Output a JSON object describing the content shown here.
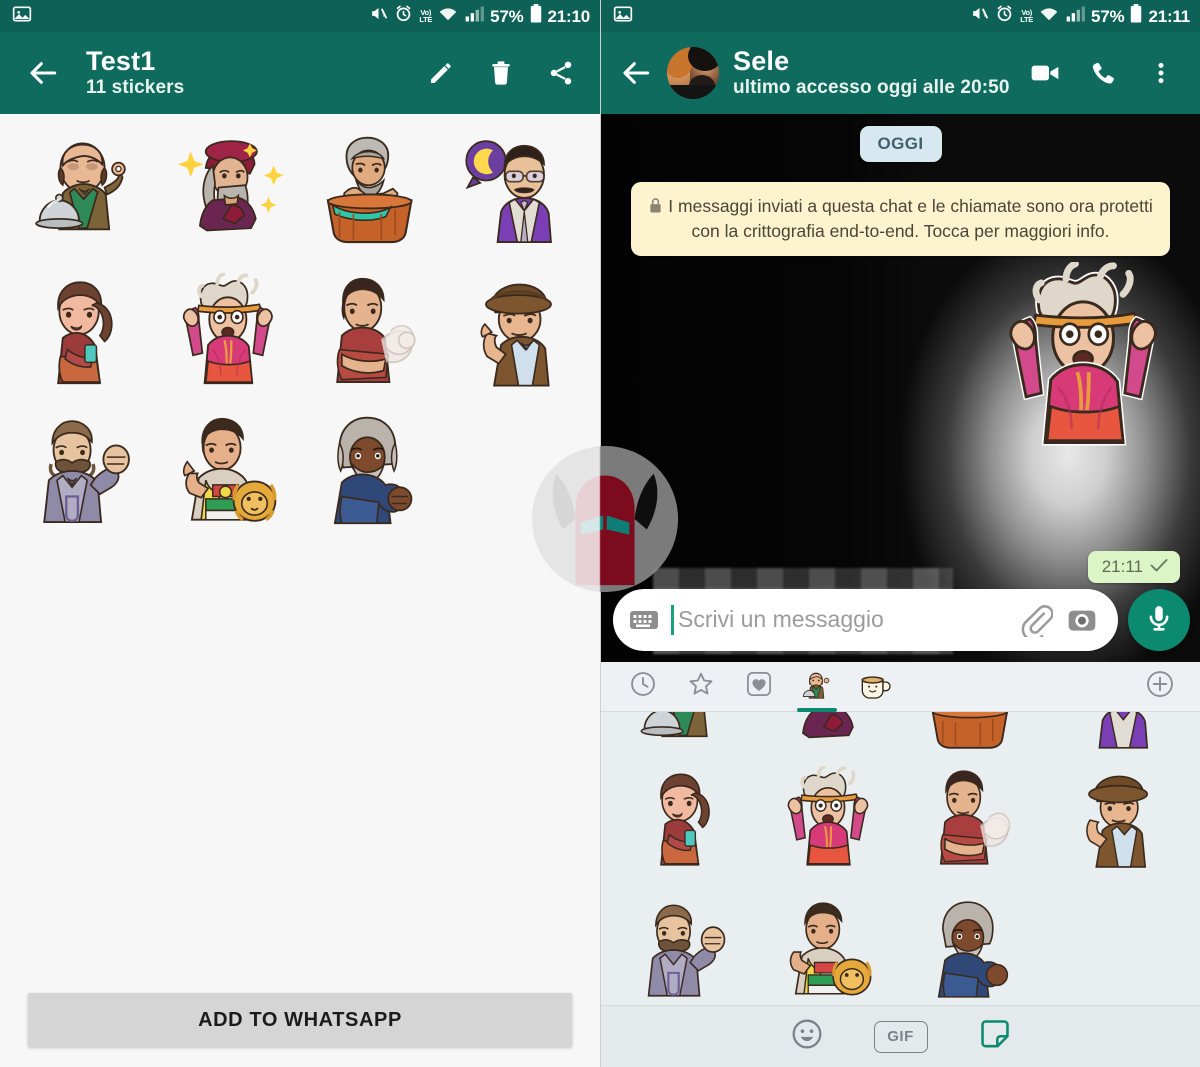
{
  "status_bar": {
    "left_icon": "gallery-icon",
    "icons": [
      "mute-icon",
      "alarm-icon",
      "volte-icon",
      "wifi-icon",
      "signal-icon"
    ],
    "volte_top": "Vo)",
    "volte_bottom": "LTE",
    "battery_percent": "57%",
    "battery_icon": "battery-icon",
    "time_left": "21:10",
    "time_right": "21:11"
  },
  "left_panel": {
    "back_icon": "back-arrow-icon",
    "title": "Test1",
    "subtitle": "11 stickers",
    "actions": [
      {
        "name": "edit-icon",
        "label": "Modifica"
      },
      {
        "name": "delete-icon",
        "label": "Elimina"
      },
      {
        "name": "share-icon",
        "label": "Condividi"
      }
    ],
    "add_button_label": "ADD TO WHATSAPP",
    "sticker_count": 11,
    "stickers": [
      {
        "id": "chef-bald-man",
        "label": "Uomo calvo con coperchio"
      },
      {
        "id": "leonardo-da-vinci",
        "label": "Leonardo da Vinci"
      },
      {
        "id": "archimedes-bathtub",
        "label": "Archimede nella vasca"
      },
      {
        "id": "moon-thinker",
        "label": "Uomo con pensiero luna"
      },
      {
        "id": "sad-woman",
        "label": "Donna triste"
      },
      {
        "id": "shocked-einstein",
        "label": "Einstein scioccato"
      },
      {
        "id": "muscle-arm-man",
        "label": "Uomo con braccio muscoloso"
      },
      {
        "id": "detective-hat-man",
        "label": "Detective con cappello"
      },
      {
        "id": "nietzsche-fist",
        "label": "Nietzsche con pugno"
      },
      {
        "id": "napoleon-lion",
        "label": "Napoleone con leone"
      },
      {
        "id": "frederick-douglass",
        "label": "Uomo con barba bianca"
      }
    ]
  },
  "right_panel": {
    "back_icon": "back-arrow-icon",
    "avatar": "contact-avatar",
    "contact_name": "Sele",
    "contact_status": "ultimo accesso oggi alle 20:50",
    "actions": [
      {
        "name": "video-call-icon",
        "label": "Videochiamata"
      },
      {
        "name": "voice-call-icon",
        "label": "Chiamata"
      },
      {
        "name": "overflow-menu-icon",
        "label": "Altro"
      }
    ],
    "date_chip": "OGGI",
    "encryption_notice": "I messaggi inviati a questa chat e le chiamate sono ora protetti con la crittografia end-to-end. Tocca per maggiori info.",
    "encryption_lock_icon": "lock-icon",
    "message": {
      "sticker_id": "shocked-einstein",
      "time": "21:11",
      "status_icon": "sent-check-icon"
    },
    "input": {
      "keyboard_icon": "keyboard-icon",
      "placeholder": "Scrivi un messaggio",
      "value": "",
      "attach_icon": "paperclip-icon",
      "camera_icon": "camera-icon",
      "mic_icon": "microphone-icon"
    },
    "sticker_tabs": [
      {
        "name": "recent-tab",
        "icon": "clock-icon",
        "selected": false
      },
      {
        "name": "starred-tab",
        "icon": "star-icon",
        "selected": false
      },
      {
        "name": "favorites-tab",
        "icon": "heart-icon",
        "selected": false
      },
      {
        "name": "pack-test1-tab",
        "icon": "sticker-pack-icon",
        "selected": true
      },
      {
        "name": "pack-cuppy-tab",
        "icon": "cup-sticker-icon",
        "selected": false
      }
    ],
    "sticker_add_icon": "plus-circle-icon",
    "panel_stickers_row_partial": [
      "chef-bald-man",
      "leonardo-da-vinci",
      "archimedes-bathtub",
      "moon-thinker"
    ],
    "panel_stickers": [
      "sad-woman",
      "shocked-einstein",
      "muscle-arm-man",
      "detective-hat-man",
      "nietzsche-fist",
      "napoleon-lion",
      "frederick-douglass"
    ],
    "bottom_nav": [
      {
        "name": "emoji-tab",
        "icon": "smiley-icon",
        "label": "",
        "selected": false
      },
      {
        "name": "gif-tab",
        "icon": "gif-icon",
        "label": "GIF",
        "selected": false
      },
      {
        "name": "sticker-tab",
        "icon": "sticker-icon",
        "label": "",
        "selected": true
      }
    ]
  },
  "watermark": {
    "name": "horned-helmet-watermark"
  },
  "colors": {
    "statusbar": "#0d6157",
    "appbar": "#0e6b5d",
    "accent_green": "#0b8a6f",
    "date_chip_bg": "#d8e8f0",
    "encryption_bg": "#fdf4cf",
    "time_chip_bg": "#dcf5c6",
    "panel_bg": "#e9eef1",
    "add_button_bg": "#d5d5d5"
  }
}
